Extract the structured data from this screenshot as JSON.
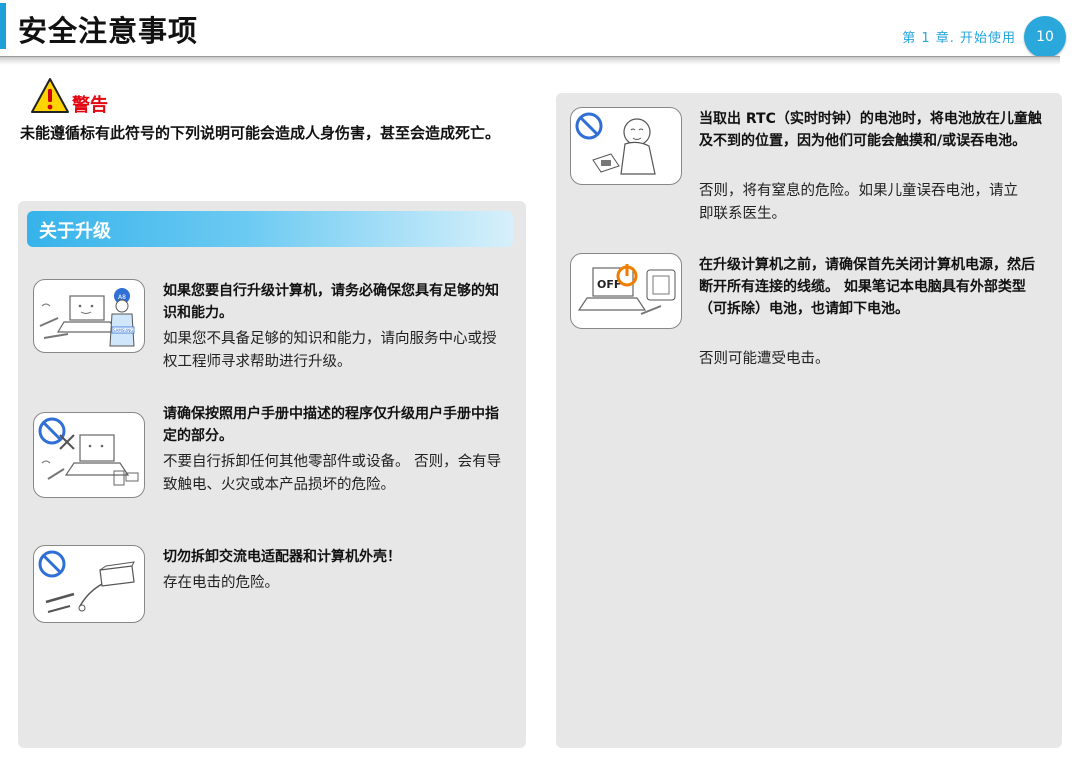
{
  "header": {
    "title": "安全注意事项",
    "chapter": "第 1 章. 开始使用",
    "page_number": "10"
  },
  "warning": {
    "label": "警告",
    "text": "未能遵循标有此符号的下列说明可能会造成人身伤害，甚至会造成死亡。"
  },
  "left_section": {
    "title": "关于升级",
    "items": [
      {
        "title": "如果您要自行升级计算机，请务必确保您具有足够的知识和能力。",
        "body": "如果您不具备足够的知识和能力，请向服务中心或授权工程师寻求帮助进行升级。",
        "icon": "technician-laptop-icon",
        "badge": "SAMSUNG"
      },
      {
        "title": "请确保按照用户手册中描述的程序仅升级用户手册中指定的部分。",
        "body": "不要自行拆卸任何其他零部件或设备。 否则，会有导致触电、火灾或本产品损坏的危险。",
        "icon": "no-disassemble-laptop-icon"
      },
      {
        "title": "切勿拆卸交流电适配器和计算机外壳！",
        "body": "存在电击的危险。",
        "icon": "no-disassemble-adapter-icon"
      }
    ]
  },
  "right_section": {
    "items": [
      {
        "title": "当取出 RTC（实时时钟）的电池时，将电池放在儿童触及不到的位置，因为他们可能会触摸和/或误吞电池。",
        "body": "否则，将有窒息的危险。如果儿童误吞电池，请立即联系医生。",
        "icon": "child-battery-icon"
      },
      {
        "title": "在升级计算机之前，请确保首先关闭计算机电源，然后断开所有连接的线缆。 如果笔记本电脑具有外部类型（可拆除）电池，也请卸下电池。",
        "body": "否则可能遭受电击。",
        "icon": "power-off-icon",
        "off_text": "OFF"
      }
    ]
  },
  "colors": {
    "accent": "#1e9fd8",
    "warning_red": "#e30613",
    "prohibit_blue": "#2f6fd6",
    "power_orange": "#f07d00",
    "panel_bg": "#e7e7e7"
  }
}
